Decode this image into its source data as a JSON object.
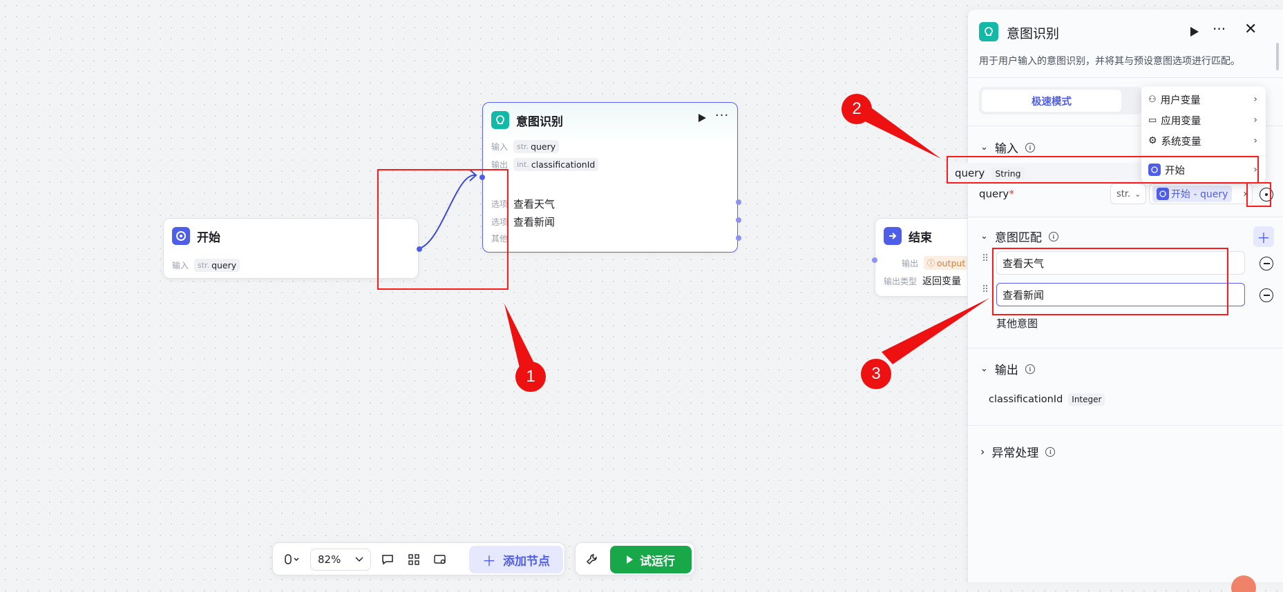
{
  "nodes": {
    "start": {
      "title": "开始",
      "input_label": "输入",
      "input_type": "str.",
      "input_var": "query"
    },
    "intent": {
      "title": "意图识别",
      "input_label": "输入",
      "input_type": "str.",
      "input_var": "query",
      "output_label": "输出",
      "output_type": "int.",
      "output_var": "classificationId",
      "option_label": "选项",
      "options": [
        "查看天气",
        "查看新闻"
      ],
      "other_label": "其他"
    },
    "end": {
      "title": "结束",
      "output_label": "输出",
      "output_var": "output",
      "output_type_label": "输出类型",
      "output_type_value": "返回变量"
    }
  },
  "annotations": [
    "1",
    "2",
    "3"
  ],
  "toolbar": {
    "zoom": "82%",
    "add_node": "添加节点",
    "test_run": "试运行"
  },
  "panel": {
    "title": "意图识别",
    "description": "用于用户输入的意图识别，并将其与预设意图选项进行匹配。",
    "mode_tab": "极速模式",
    "input_section": "输入",
    "suggestion": {
      "var": "query",
      "type": "String"
    },
    "param_name": "query",
    "param_required": "*",
    "param_type": "str.",
    "param_value": "开始 - query",
    "intent_section": "意图匹配",
    "intents": [
      "查看天气",
      "查看新闻"
    ],
    "other_intent": "其他意图",
    "output_section": "输出",
    "output_var": "classificationId",
    "output_type": "Integer",
    "exception_section": "异常处理"
  },
  "menu": {
    "items": [
      "用户变量",
      "应用变量",
      "系统变量",
      "开始"
    ]
  },
  "colors": {
    "accent": "#4f5ee8",
    "annotation": "#ee1111",
    "run": "#18a84a",
    "teal": "#14b8a6"
  }
}
